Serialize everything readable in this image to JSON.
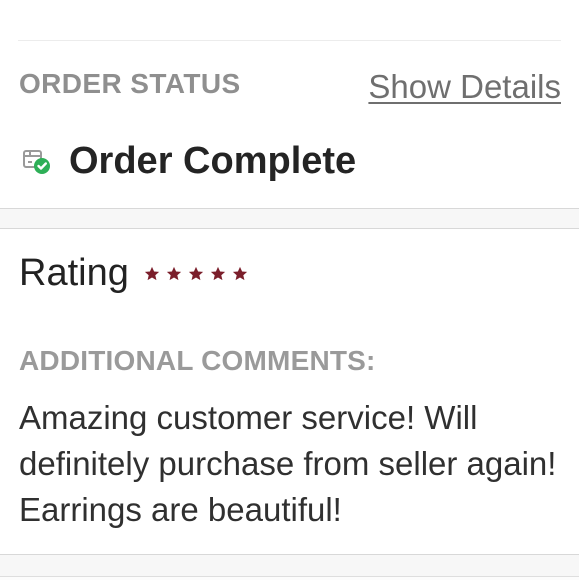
{
  "order": {
    "status_label": "ORDER STATUS",
    "show_details_label": "Show Details",
    "status_text": "Order Complete",
    "status_icon": "package-check-icon"
  },
  "review": {
    "rating_label": "Rating",
    "rating_value": 5,
    "rating_max": 5,
    "star_color": "#7b1e2b",
    "comments_label": "ADDITIONAL COMMENTS:",
    "comment_text": "Amazing customer service! Will definitely purchase from seller again! Earrings are beautiful!"
  },
  "colors": {
    "background": "#ffffff",
    "section_band": "#f7f7f7",
    "divider": "#d8d8d8",
    "muted_label": "#8f8f8f",
    "link": "#6f6f6f",
    "success": "#2eaf57",
    "text": "#222222"
  }
}
